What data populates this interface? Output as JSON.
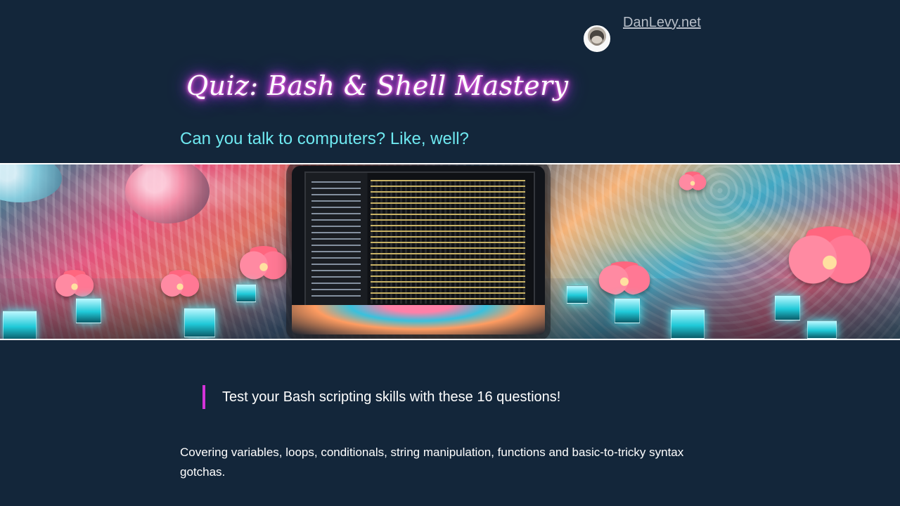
{
  "header": {
    "site_name": "DanLevy.net",
    "avatar": "author-avatar"
  },
  "hero": {
    "title": "Quiz: Bash & Shell Mastery",
    "subtitle": "Can you talk to computers? Like, well?",
    "image": "terminal-laptop-in-psychedelic-landscape"
  },
  "content": {
    "callout": "Test your Bash scripting skills with these 16 questions!",
    "description": "Covering variables, loops, conditionals, string manipulation, functions and basic-to-tricky syntax gotchas."
  },
  "colors": {
    "background": "#13263a",
    "title_glow": "#ff3fd0",
    "subtitle": "#6ee8f0",
    "callout_border": "#d433d9",
    "link": "#b7bec8"
  }
}
